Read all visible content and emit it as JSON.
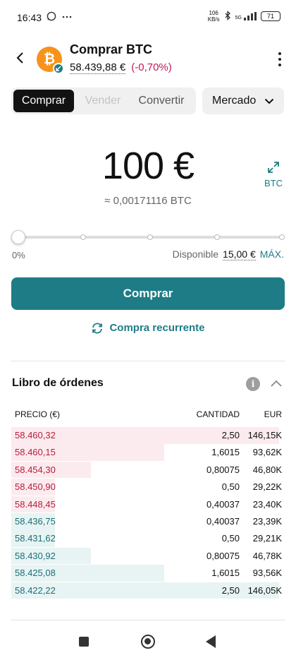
{
  "status_bar": {
    "time": "16:43",
    "left_icons": [
      "whatsapp-icon",
      "more-dots-icon"
    ],
    "speed_value": "106",
    "speed_unit": "KB/s",
    "network": "5G",
    "battery": "71"
  },
  "header": {
    "title": "Comprar BTC",
    "price": "58.439,88 €",
    "change": "(-0,70%)",
    "coin_symbol": "₿",
    "accent_color": "#1e7c86",
    "negative_color": "#c2185b"
  },
  "tabs": [
    {
      "label": "Comprar",
      "state": "active"
    },
    {
      "label": "Vender",
      "state": "disabled"
    },
    {
      "label": "Convertir",
      "state": "normal"
    }
  ],
  "order_type": {
    "selected": "Mercado"
  },
  "amount": {
    "value": "100 €",
    "converted": "≈ 0,00171116 BTC",
    "swap_label": "BTC"
  },
  "slider": {
    "percent_label": "0%",
    "value": 0,
    "available_label": "Disponible",
    "available_value": "15,00 €",
    "max_label": "MÁX."
  },
  "buy_button": "Comprar",
  "recurring": "Compra recurrente",
  "order_book": {
    "title": "Libro de órdenes",
    "columns": [
      "PRECIO (€)",
      "CANTIDAD",
      "EUR"
    ],
    "asks": [
      {
        "price": "58.460,32",
        "qty": "2,50",
        "eur": "146,15K",
        "depth": 0.98
      },
      {
        "price": "58.460,15",
        "qty": "1,6015",
        "eur": "93,62K",
        "depth": 0.56
      },
      {
        "price": "58.454,30",
        "qty": "0,80075",
        "eur": "46,80K",
        "depth": 0.29
      },
      {
        "price": "58.450,90",
        "qty": "0,50",
        "eur": "29,22K",
        "depth": 0.16
      },
      {
        "price": "58.448,45",
        "qty": "0,40037",
        "eur": "23,40K",
        "depth": 0.16
      }
    ],
    "bids": [
      {
        "price": "58.436,75",
        "qty": "0,40037",
        "eur": "23,39K",
        "depth": 0.16
      },
      {
        "price": "58.431,62",
        "qty": "0,50",
        "eur": "29,21K",
        "depth": 0.16
      },
      {
        "price": "58.430,92",
        "qty": "0,80075",
        "eur": "46,78K",
        "depth": 0.29
      },
      {
        "price": "58.425,08",
        "qty": "1,6015",
        "eur": "93,56K",
        "depth": 0.56
      },
      {
        "price": "58.422,22",
        "qty": "2,50",
        "eur": "146,05K",
        "depth": 0.98
      }
    ]
  }
}
